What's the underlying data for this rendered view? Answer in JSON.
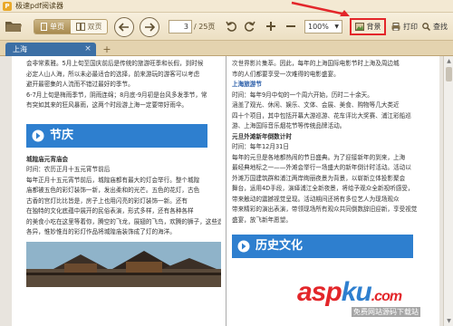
{
  "app": {
    "title": "极速pdf阅读器"
  },
  "toolbar": {
    "view_single": "单页",
    "view_double": "双页",
    "page_current": "3",
    "page_total": "/ 25页",
    "zoom_value": "100%",
    "background_label": "背景",
    "print_label": "打印",
    "search_label": "查找"
  },
  "tabs": [
    {
      "label": "上海"
    }
  ],
  "document": {
    "left": {
      "top_lines": [
        "会非常素雅。5月上旬至国庆前后是传统的旅游旺季和长假，到时候",
        "必定人山人海，所以未必最适合的选择，前来游玩的游客可以考虑",
        "避开最密集的人流而不错过最好的季节。",
        "6-7月上旬是梅雨季节，阴雨连绵；8月底-9月初是台风多发季节，常",
        "有突如其来的狂风暴雨，这两个时段游上海一定要带好雨伞。"
      ],
      "banner_title": "节庆",
      "festival_name": "城隍庙元宵庙会",
      "festival_time": "时间：农历正月十五元宵节前后",
      "festival_desc": [
        "每年正月十五元宵节前后，城隍庙都有最大的灯会举行。整个城隍",
        "庙都被五色的彩灯装饰一新，发出柔和的光芒。五色的花灯，古色",
        "古香的宫灯比比皆是，房子上也用闪亮的彩灯装饰一新。还有",
        "在独特的文化底蕴中展开的民俗表演，形式多样，还有各种各样",
        "的美食小吃在这里等着你，腾空的飞龙，展翅的飞鸟，欢腾的狮子，这些造型",
        "各异，惟妙惟肖的彩灯作品将城隍庙装饰成了灯的海洋。"
      ]
    },
    "right": {
      "top_lines": [
        "次世界影片集萃。因此，每年的上海国际电影节时上海及周边城",
        "市的人们都要享受一次难得的电影盛宴。"
      ],
      "section1_title": "上海旅游节",
      "section1_lines": [
        "时间：每年9月中旬的一个周六开始，历时二十余天。",
        "涵盖了观光、休闲、娱乐、文体、会展、美食、购物等几大类近",
        "四十个项目，其中包括开幕大游巡游、花车评比大奖赛、浦江彩船巡",
        "游、上海国际音乐烟花节等传统品牌活动。"
      ],
      "section2_title": "元旦外滩新年倒数计时",
      "section2_lines": [
        "时间：每年12月31日",
        "每年的元旦是各地都热闹的节日盛典。为了迎接新年的到来，上海",
        "最经典地标之一——外滩会举行一场盛大的新年倒计时活动。活动以",
        "外滩万国建筑群和浦江两岸绚丽夜景为背景，以崭新立体投影聚会",
        "舞台，运用4D手段，演绎浦江全新夜景，将给予观众全新视听感受，",
        "带来触动的震撼视觉呈现。活动期间还将有多位艺人为现场观众",
        "带来精彩的演出表演，带领现场所有观众共同倒数辞旧迎新，享受视觉",
        "盛宴，放飞新年愿望。"
      ],
      "banner_title": "历史文化"
    }
  },
  "watermark": {
    "text_a": "asp",
    "text_b": "ku",
    "text_c": ".com",
    "sub": "免费网站源码下载站"
  },
  "colors": {
    "toolbar_bg": "#f0e5cb",
    "tab_active": "#3c6fa5",
    "banner": "#2e7fcf",
    "annotation_red": "#e3262a",
    "heading_blue": "#2a5da8"
  }
}
